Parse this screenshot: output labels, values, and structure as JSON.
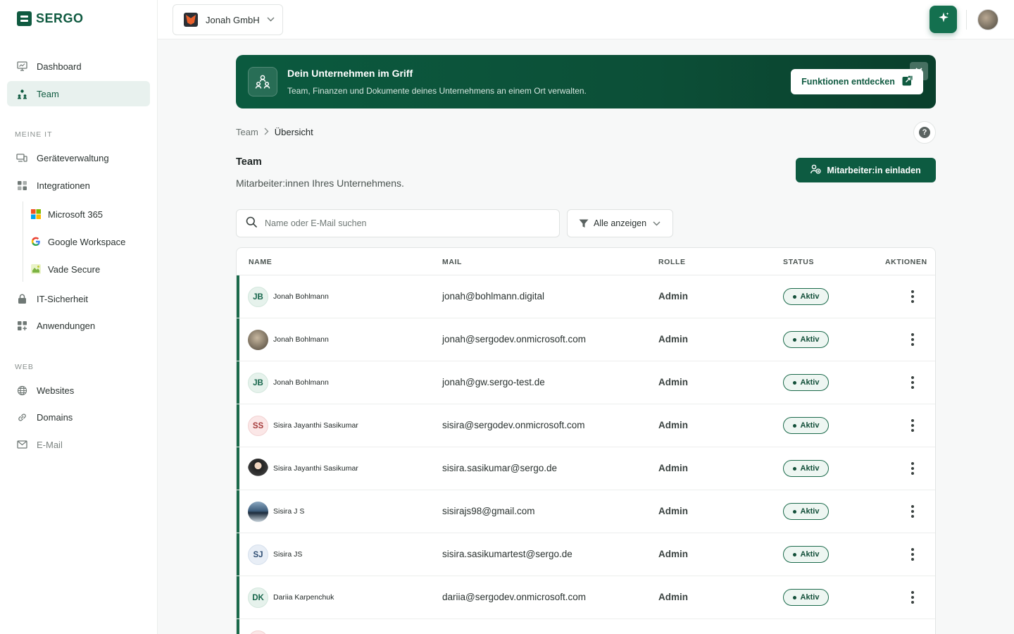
{
  "app": {
    "name": "SERGO"
  },
  "sidebar": {
    "dashboard": "Dashboard",
    "team": "Team",
    "section_it": "MEINE IT",
    "devices": "Geräteverwaltung",
    "integrations": "Integrationen",
    "integration_items": [
      "Microsoft 365",
      "Google Workspace",
      "Vade Secure"
    ],
    "security": "IT-Sicherheit",
    "apps": "Anwendungen",
    "section_web": "WEB",
    "websites": "Websites",
    "domains": "Domains",
    "email": "E-Mail"
  },
  "topbar": {
    "company": "Jonah GmbH"
  },
  "banner": {
    "title": "Dein Unternehmen im Griff",
    "subtitle": "Team, Finanzen und Dokumente deines Unternehmens an einem Ort verwalten.",
    "button": "Funktionen entdecken"
  },
  "breadcrumb": {
    "parent": "Team",
    "current": "Übersicht"
  },
  "page": {
    "title": "Team",
    "subtitle": "Mitarbeiter:innen Ihres Unternehmens.",
    "invite": "Mitarbeiter:in einladen"
  },
  "search": {
    "placeholder": "Name oder E-Mail suchen"
  },
  "filter": {
    "label": "Alle anzeigen"
  },
  "table": {
    "columns": [
      "NAME",
      "MAIL",
      "ROLLE",
      "STATUS",
      "AKTIONEN"
    ],
    "rows": [
      {
        "initials": "JB",
        "name": "Jonah Bohlmann",
        "mail": "jonah@bohlmann.digital",
        "role": "Admin",
        "status": "Aktiv"
      },
      {
        "initials": "",
        "name": "Jonah Bohlmann",
        "mail": "jonah@sergodev.onmicrosoft.com",
        "role": "Admin",
        "status": "Aktiv"
      },
      {
        "initials": "JB",
        "name": "Jonah Bohlmann",
        "mail": "jonah@gw.sergo-test.de",
        "role": "Admin",
        "status": "Aktiv"
      },
      {
        "initials": "SS",
        "name": "Sisira Jayanthi Sasikumar",
        "mail": "sisira@sergodev.onmicrosoft.com",
        "role": "Admin",
        "status": "Aktiv"
      },
      {
        "initials": "",
        "name": "Sisira Jayanthi Sasikumar",
        "mail": "sisira.sasikumar@sergo.de",
        "role": "Admin",
        "status": "Aktiv"
      },
      {
        "initials": "",
        "name": "Sisira J S",
        "mail": "sisirajs98@gmail.com",
        "role": "Admin",
        "status": "Aktiv"
      },
      {
        "initials": "SJ",
        "name": "Sisira JS",
        "mail": "sisira.sasikumartest@sergo.de",
        "role": "Admin",
        "status": "Aktiv"
      },
      {
        "initials": "DK",
        "name": "Dariia Karpenchuk",
        "mail": "dariia@sergodev.onmicrosoft.com",
        "role": "Admin",
        "status": "Aktiv"
      }
    ]
  },
  "colors": {
    "brand": "#0f5a40",
    "accent": "#1b6a4b"
  }
}
